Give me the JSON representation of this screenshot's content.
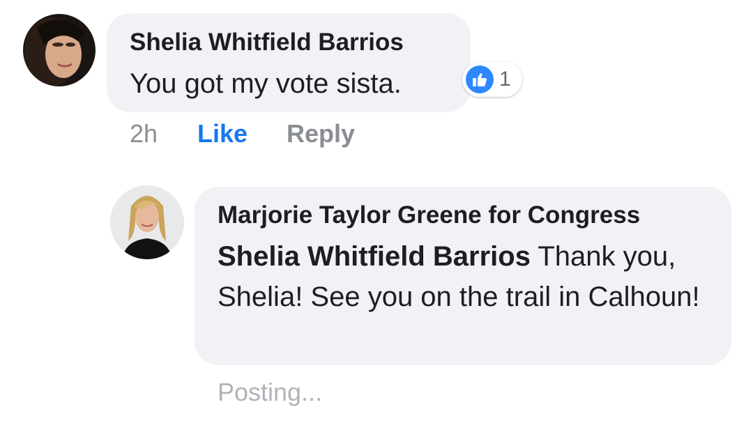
{
  "comment": {
    "author": "Shelia Whitfield Barrios",
    "text": "You got my vote sista.",
    "reaction_count": "1",
    "time": "2h",
    "like_label": "Like",
    "reply_label": "Reply",
    "reaction_icon": "thumbs-up-icon",
    "accent_color": "#1877f2"
  },
  "reply": {
    "author": "Marjorie Taylor Greene for Congress",
    "mention": "Shelia Whitfield Barrios",
    "text": " Thank you, Shelia! See you on the trail in Calhoun!",
    "status": "Posting..."
  }
}
